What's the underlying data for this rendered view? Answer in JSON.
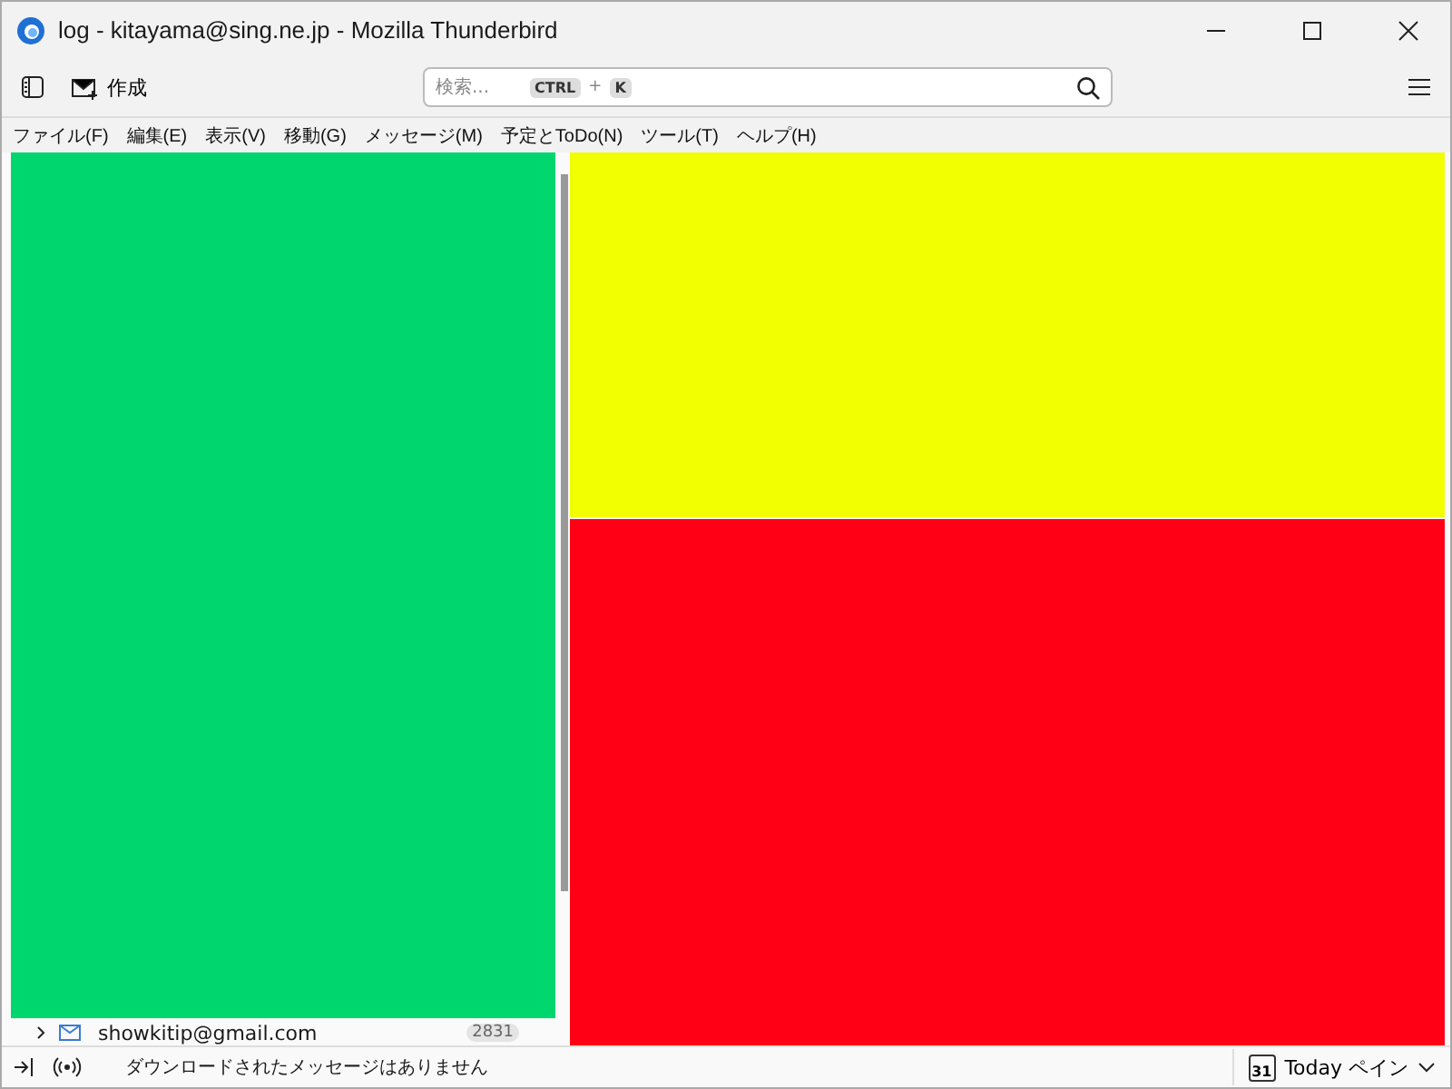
{
  "window": {
    "title": "log - kitayama@sing.ne.jp - Mozilla Thunderbird"
  },
  "toolbar": {
    "compose_label": "作成",
    "search": {
      "placeholder": "検索...",
      "keys": [
        "CTRL",
        "+",
        "K"
      ]
    }
  },
  "menu": [
    "ファイル(F)",
    "編集(E)",
    "表示(V)",
    "移動(G)",
    "メッセージ(M)",
    "予定とToDo(N)",
    "ツール(T)",
    "ヘルプ(H)"
  ],
  "folder_pane": {
    "account": {
      "name": "showkitip@gmail.com",
      "count": "2831"
    }
  },
  "status_bar": {
    "text": "ダウンロードされたメッセージはありません",
    "today_pane": "Today ペイン",
    "calendar_day": "31"
  }
}
